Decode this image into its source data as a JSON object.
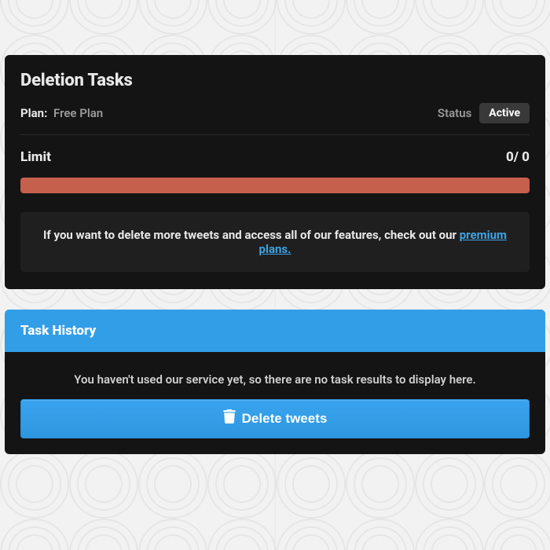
{
  "deletion_tasks": {
    "title": "Deletion Tasks",
    "plan_label": "Plan:",
    "plan_value": "Free Plan",
    "status_label": "Status",
    "status_value": "Active",
    "limit_label": "Limit",
    "limit_used": 0,
    "limit_total": 0,
    "limit_display": "0/ 0",
    "progress_percent": 100,
    "progress_color": "#c5604d",
    "upsell_prefix": "If you want to delete more tweets and access all of our features, check out our ",
    "upsell_link_text": "premium plans."
  },
  "task_history": {
    "title": "Task History",
    "empty_message": "You haven't used our service yet, so there are no task results to display here.",
    "button_label": "Delete tweets",
    "button_icon": "trash-icon"
  },
  "colors": {
    "accent_blue": "#329ee8",
    "card_bg": "#141414",
    "upsell_bg": "#1f1f1f",
    "badge_bg": "#393939"
  }
}
